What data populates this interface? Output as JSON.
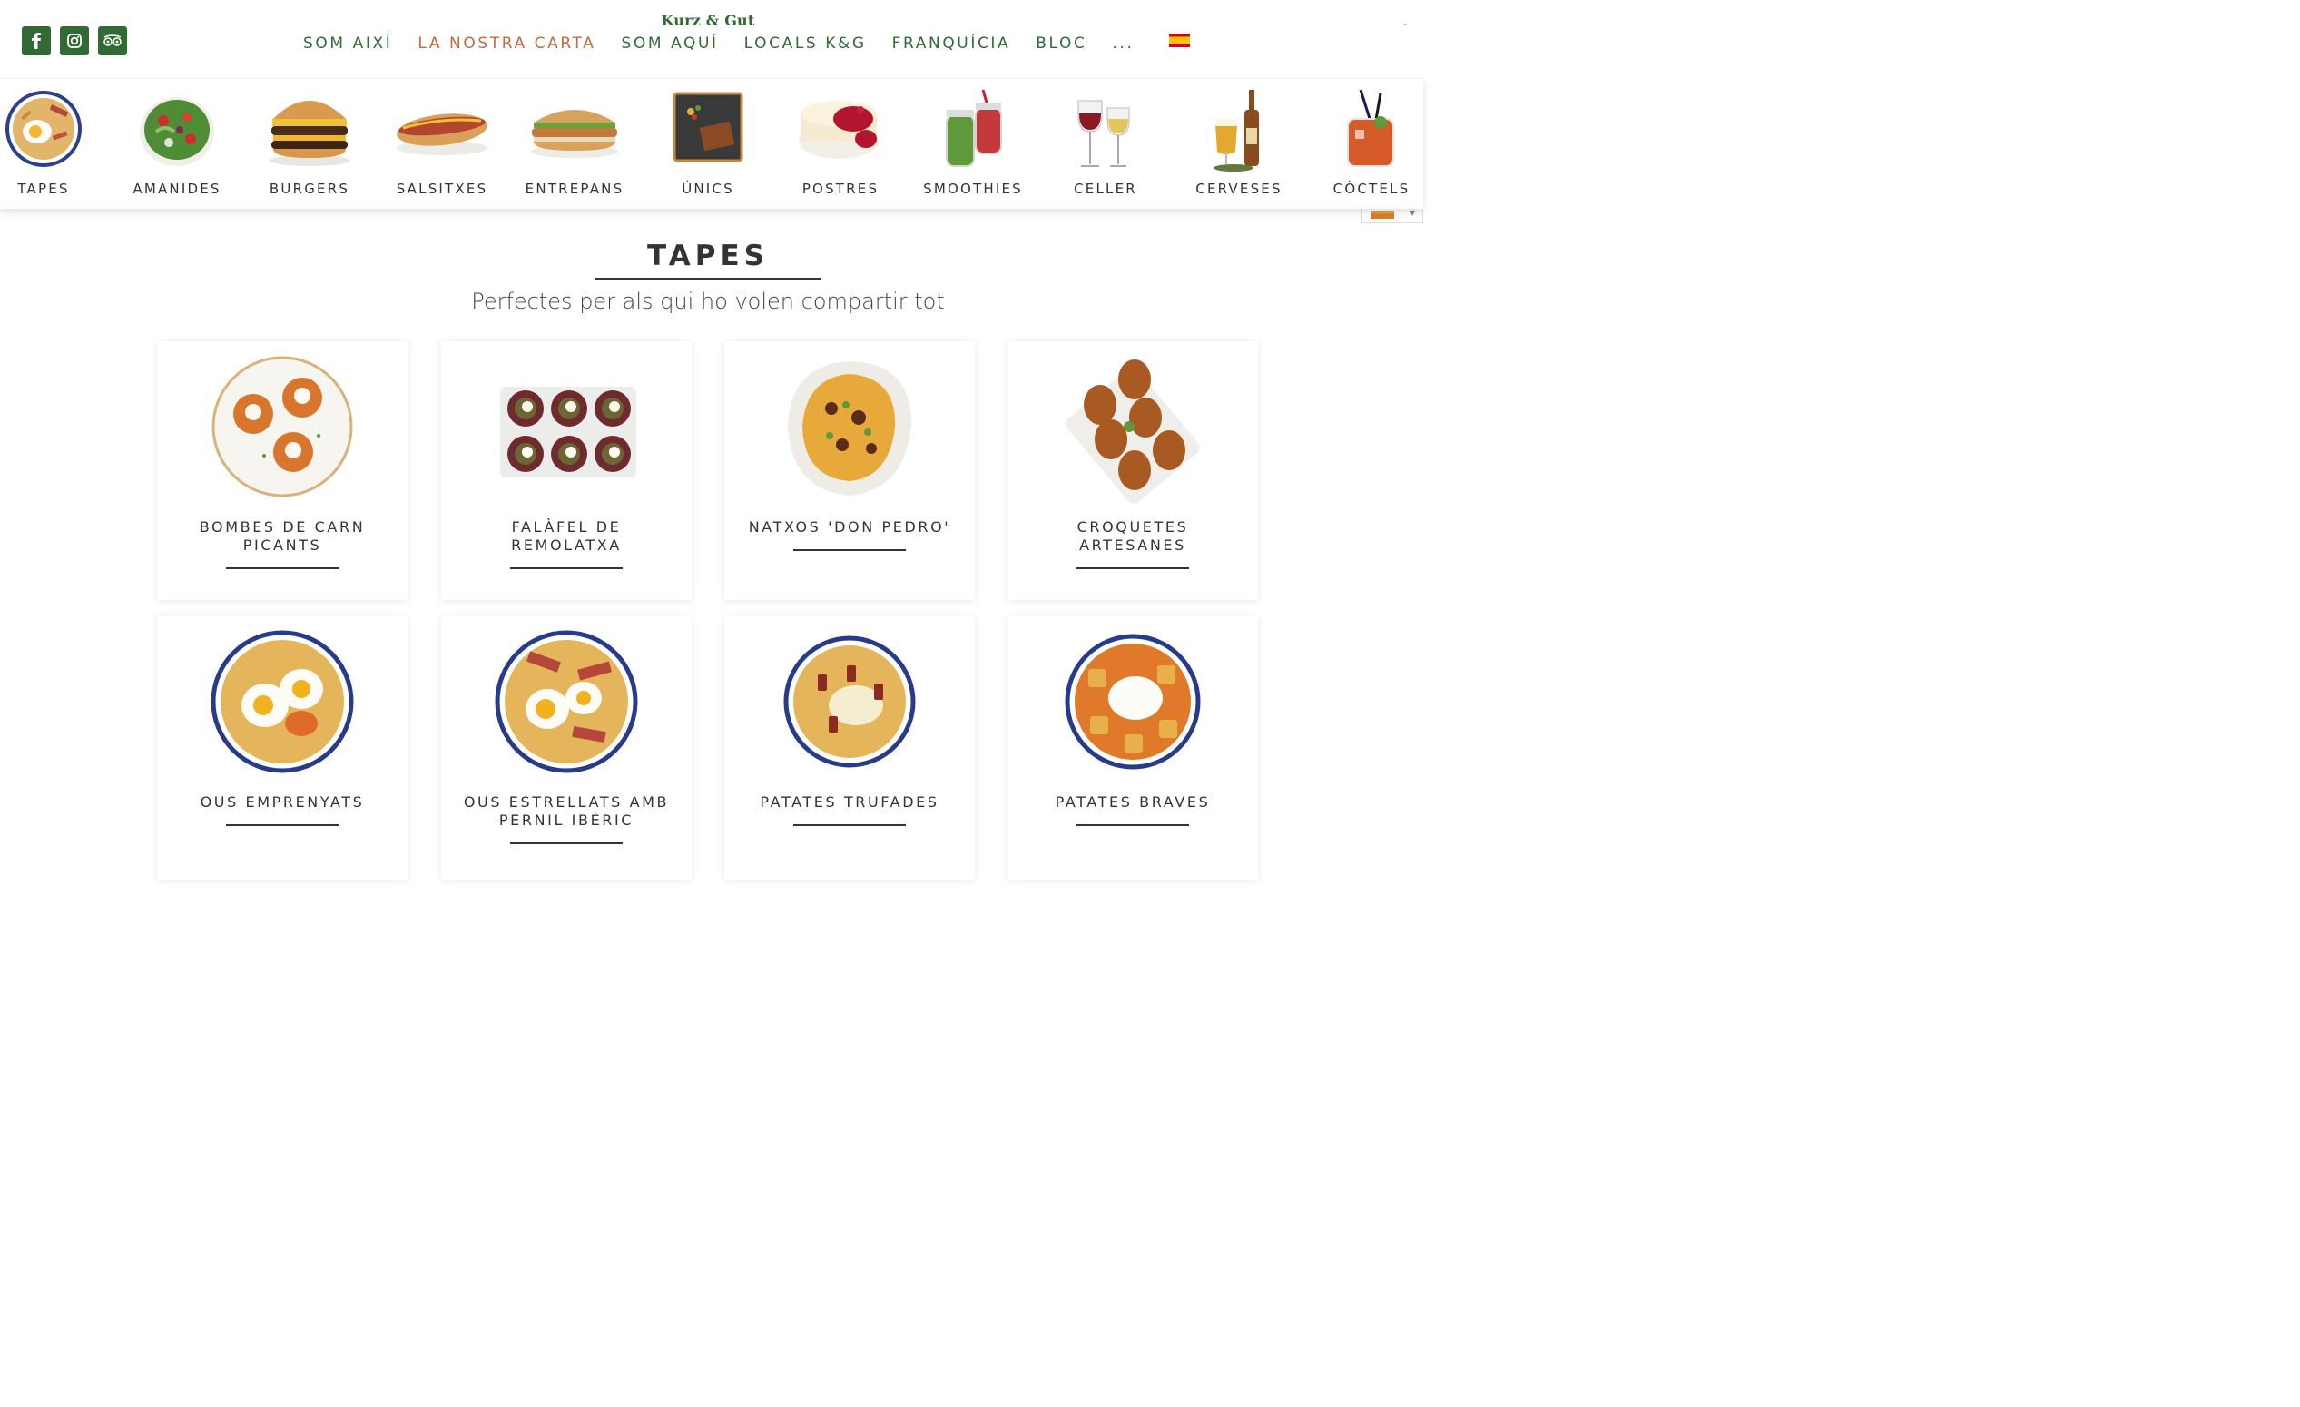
{
  "brand": "Kurz & Gut",
  "socials": [
    {
      "icon": "facebook-icon"
    },
    {
      "icon": "instagram-icon"
    },
    {
      "icon": "tripadvisor-icon"
    }
  ],
  "nav": {
    "items": [
      {
        "label": "SOM AIXÍ",
        "active": false
      },
      {
        "label": "LA NOSTRA CARTA",
        "active": true
      },
      {
        "label": "SOM AQUÍ",
        "active": false
      },
      {
        "label": "LOCALS K&G",
        "active": false
      },
      {
        "label": "FRANQUÍCIA",
        "active": false
      },
      {
        "label": "BLOC",
        "active": false
      },
      {
        "label": "...",
        "active": false
      }
    ],
    "language_flag": "spain-flag-icon"
  },
  "categories": [
    {
      "label": "TAPES",
      "icon": "tapas-dish-image"
    },
    {
      "label": "AMANIDES",
      "icon": "salad-bowl-image"
    },
    {
      "label": "BURGERS",
      "icon": "burger-image"
    },
    {
      "label": "SALSITXES",
      "icon": "hotdog-image"
    },
    {
      "label": "ENTREPANS",
      "icon": "sandwich-image"
    },
    {
      "label": "ÚNICS",
      "icon": "slate-plate-image"
    },
    {
      "label": "POSTRES",
      "icon": "cheesecake-image"
    },
    {
      "label": "SMOOTHIES",
      "icon": "smoothie-jars-image"
    },
    {
      "label": "CELLER",
      "icon": "wine-glasses-image"
    },
    {
      "label": "CERVESES",
      "icon": "beer-image"
    },
    {
      "label": "CÒCTELS",
      "icon": "cocktail-image"
    }
  ],
  "section": {
    "title": "TAPES",
    "subtitle": "Perfectes per als qui ho volen compartir tot"
  },
  "products": [
    {
      "name": "BOMBES DE CARN PICANTS",
      "image": "meat-bombs-image"
    },
    {
      "name": "FALÀFEL DE REMOLATXA",
      "image": "beet-falafel-image"
    },
    {
      "name": "NATXOS 'DON PEDRO'",
      "image": "nachos-image"
    },
    {
      "name": "CROQUETES ARTESANES",
      "image": "croquettes-image"
    },
    {
      "name": "OUS EMPRENYATS",
      "image": "fried-eggs-fries-image"
    },
    {
      "name": "OUS ESTRELLATS AMB PERNIL IBÈRIC",
      "image": "eggs-ham-fries-image"
    },
    {
      "name": "PATATES TRUFADES",
      "image": "truffle-potatoes-image"
    },
    {
      "name": "PATATES BRAVES",
      "image": "patatas-bravas-image"
    }
  ],
  "colors": {
    "brand_green": "#2f6b32",
    "active_nav": "#c46a3a",
    "text_dark": "#333333"
  }
}
